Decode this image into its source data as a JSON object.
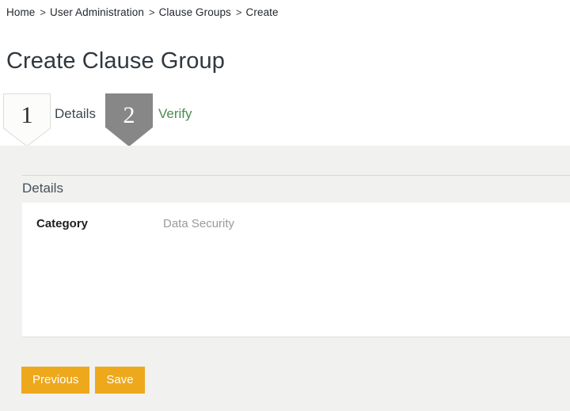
{
  "breadcrumb": {
    "separator": ">",
    "items": [
      {
        "label": "Home"
      },
      {
        "label": "User Administration"
      },
      {
        "label": "Clause Groups"
      },
      {
        "label": "Create"
      }
    ]
  },
  "header": {
    "title": "Create Clause Group"
  },
  "wizard": {
    "steps": [
      {
        "number": "1",
        "label": "Details",
        "state": "current"
      },
      {
        "number": "2",
        "label": "Verify",
        "state": "upcoming"
      }
    ]
  },
  "main": {
    "section_title": "Details",
    "fields": [
      {
        "label": "Category",
        "value": "Data Security"
      }
    ]
  },
  "actions": {
    "previous_label": "Previous",
    "save_label": "Save"
  },
  "colors": {
    "accent_orange": "#eda81c",
    "step_current_fill": "#fcfcfb",
    "step_upcoming_fill": "#878787",
    "verify_green": "#4a8d4f",
    "page_background": "#ffffff",
    "content_background": "#f1f1ef",
    "panel_background": "#ffffff"
  }
}
